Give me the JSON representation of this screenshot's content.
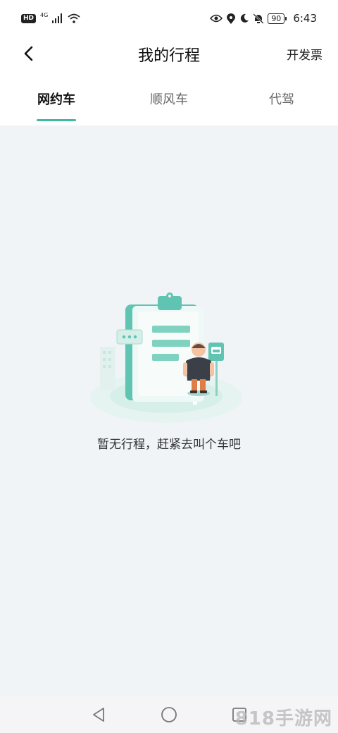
{
  "status_bar": {
    "hd": "HD",
    "signal_tag": "4G",
    "battery": "90",
    "time": "6:43"
  },
  "header": {
    "title": "我的行程",
    "invoice_label": "开发票"
  },
  "tabs": [
    {
      "label": "网约车",
      "active": true
    },
    {
      "label": "顺风车",
      "active": false
    },
    {
      "label": "代驾",
      "active": false
    }
  ],
  "empty_state": {
    "message": "暂无行程，赶紧去叫个车吧"
  },
  "watermark": "818手游网",
  "colors": {
    "accent": "#3fb9a6",
    "background": "#f1f4f7"
  }
}
